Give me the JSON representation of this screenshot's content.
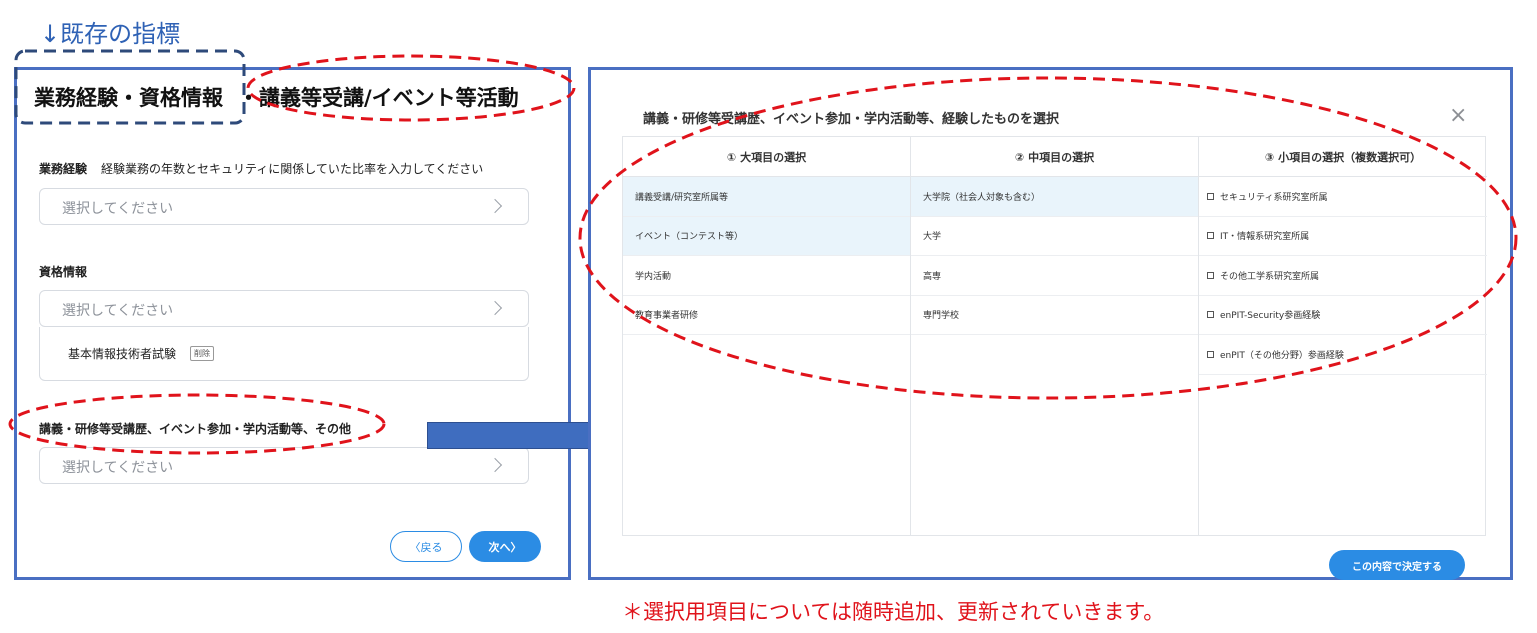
{
  "annotation": {
    "existing_label": "↓既存の指標",
    "footnote": "＊選択用項目については随時追加、更新されていきます。"
  },
  "left_panel": {
    "tab_active": "業務経験・資格情報",
    "tab_separator": "・",
    "tab_new": "講義等受講/イベント等活動",
    "business_experience": {
      "label": "業務経験",
      "description": "経験業務の年数とセキュリティに関係していた比率を入力してください",
      "placeholder": "選択してください"
    },
    "qualifications": {
      "label": "資格情報",
      "placeholder": "選択してください",
      "selected_item": "基本情報技術者試験",
      "delete_label": "削除"
    },
    "lectures": {
      "label": "講義・研修等受講歴、イベント参加・学内活動等、その他",
      "placeholder": "選択してください"
    },
    "back_button": "〈戻る",
    "next_button": "次へ〉"
  },
  "modal": {
    "title": "講義・研修等受講歴、イベント参加・学内活動等、経験したものを選択",
    "close_icon": "×",
    "columns": [
      {
        "header": "① 大項目の選択",
        "items": [
          {
            "label": "講義受講/研究室所属等",
            "selected": true
          },
          {
            "label": "イベント（コンテスト等）",
            "selected": true
          },
          {
            "label": "学内活動",
            "selected": false
          },
          {
            "label": "教育事業者研修",
            "selected": false
          }
        ]
      },
      {
        "header": "② 中項目の選択",
        "items": [
          {
            "label": "大学院（社会人対象も含む）",
            "selected": true
          },
          {
            "label": "大学",
            "selected": false
          },
          {
            "label": "高専",
            "selected": false
          },
          {
            "label": "専門学校",
            "selected": false
          }
        ]
      },
      {
        "header": "③ 小項目の選択（複数選択可）",
        "items": [
          {
            "label": "セキュリティ系研究室所属"
          },
          {
            "label": "IT・情報系研究室所属"
          },
          {
            "label": "その他工学系研究室所属"
          },
          {
            "label": "enPIT-Security参画経験"
          },
          {
            "label": "enPIT（その他分野）参画経験"
          }
        ]
      }
    ],
    "decide_button": "この内容で決定する"
  },
  "colors": {
    "panel_border": "#4a6fc2",
    "accent_blue": "#2b8ce4",
    "annotation_red": "#e0131b",
    "dashed_navy": "#2e4a7a",
    "selected_row_bg": "#e9f4fb"
  }
}
